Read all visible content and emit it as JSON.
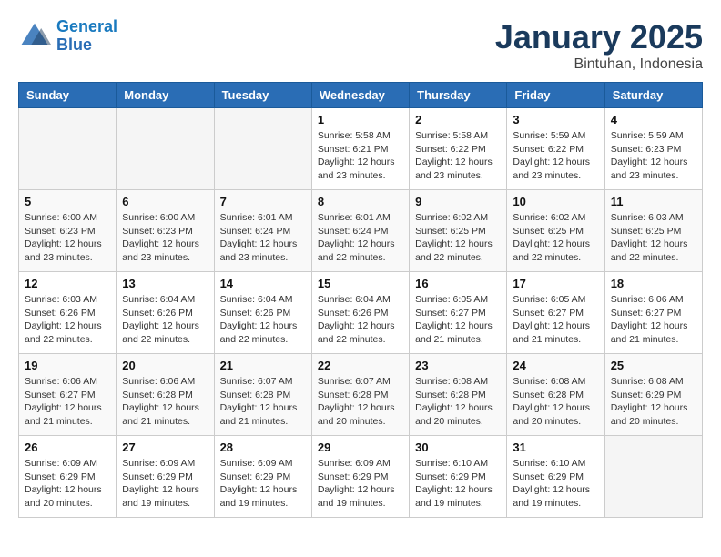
{
  "header": {
    "logo_line1": "General",
    "logo_line2": "Blue",
    "month_title": "January 2025",
    "location": "Bintuhan, Indonesia"
  },
  "weekdays": [
    "Sunday",
    "Monday",
    "Tuesday",
    "Wednesday",
    "Thursday",
    "Friday",
    "Saturday"
  ],
  "weeks": [
    [
      {
        "day": "",
        "sunrise": "",
        "sunset": "",
        "daylight": ""
      },
      {
        "day": "",
        "sunrise": "",
        "sunset": "",
        "daylight": ""
      },
      {
        "day": "",
        "sunrise": "",
        "sunset": "",
        "daylight": ""
      },
      {
        "day": "1",
        "sunrise": "Sunrise: 5:58 AM",
        "sunset": "Sunset: 6:21 PM",
        "daylight": "Daylight: 12 hours and 23 minutes."
      },
      {
        "day": "2",
        "sunrise": "Sunrise: 5:58 AM",
        "sunset": "Sunset: 6:22 PM",
        "daylight": "Daylight: 12 hours and 23 minutes."
      },
      {
        "day": "3",
        "sunrise": "Sunrise: 5:59 AM",
        "sunset": "Sunset: 6:22 PM",
        "daylight": "Daylight: 12 hours and 23 minutes."
      },
      {
        "day": "4",
        "sunrise": "Sunrise: 5:59 AM",
        "sunset": "Sunset: 6:23 PM",
        "daylight": "Daylight: 12 hours and 23 minutes."
      }
    ],
    [
      {
        "day": "5",
        "sunrise": "Sunrise: 6:00 AM",
        "sunset": "Sunset: 6:23 PM",
        "daylight": "Daylight: 12 hours and 23 minutes."
      },
      {
        "day": "6",
        "sunrise": "Sunrise: 6:00 AM",
        "sunset": "Sunset: 6:23 PM",
        "daylight": "Daylight: 12 hours and 23 minutes."
      },
      {
        "day": "7",
        "sunrise": "Sunrise: 6:01 AM",
        "sunset": "Sunset: 6:24 PM",
        "daylight": "Daylight: 12 hours and 23 minutes."
      },
      {
        "day": "8",
        "sunrise": "Sunrise: 6:01 AM",
        "sunset": "Sunset: 6:24 PM",
        "daylight": "Daylight: 12 hours and 22 minutes."
      },
      {
        "day": "9",
        "sunrise": "Sunrise: 6:02 AM",
        "sunset": "Sunset: 6:25 PM",
        "daylight": "Daylight: 12 hours and 22 minutes."
      },
      {
        "day": "10",
        "sunrise": "Sunrise: 6:02 AM",
        "sunset": "Sunset: 6:25 PM",
        "daylight": "Daylight: 12 hours and 22 minutes."
      },
      {
        "day": "11",
        "sunrise": "Sunrise: 6:03 AM",
        "sunset": "Sunset: 6:25 PM",
        "daylight": "Daylight: 12 hours and 22 minutes."
      }
    ],
    [
      {
        "day": "12",
        "sunrise": "Sunrise: 6:03 AM",
        "sunset": "Sunset: 6:26 PM",
        "daylight": "Daylight: 12 hours and 22 minutes."
      },
      {
        "day": "13",
        "sunrise": "Sunrise: 6:04 AM",
        "sunset": "Sunset: 6:26 PM",
        "daylight": "Daylight: 12 hours and 22 minutes."
      },
      {
        "day": "14",
        "sunrise": "Sunrise: 6:04 AM",
        "sunset": "Sunset: 6:26 PM",
        "daylight": "Daylight: 12 hours and 22 minutes."
      },
      {
        "day": "15",
        "sunrise": "Sunrise: 6:04 AM",
        "sunset": "Sunset: 6:26 PM",
        "daylight": "Daylight: 12 hours and 22 minutes."
      },
      {
        "day": "16",
        "sunrise": "Sunrise: 6:05 AM",
        "sunset": "Sunset: 6:27 PM",
        "daylight": "Daylight: 12 hours and 21 minutes."
      },
      {
        "day": "17",
        "sunrise": "Sunrise: 6:05 AM",
        "sunset": "Sunset: 6:27 PM",
        "daylight": "Daylight: 12 hours and 21 minutes."
      },
      {
        "day": "18",
        "sunrise": "Sunrise: 6:06 AM",
        "sunset": "Sunset: 6:27 PM",
        "daylight": "Daylight: 12 hours and 21 minutes."
      }
    ],
    [
      {
        "day": "19",
        "sunrise": "Sunrise: 6:06 AM",
        "sunset": "Sunset: 6:27 PM",
        "daylight": "Daylight: 12 hours and 21 minutes."
      },
      {
        "day": "20",
        "sunrise": "Sunrise: 6:06 AM",
        "sunset": "Sunset: 6:28 PM",
        "daylight": "Daylight: 12 hours and 21 minutes."
      },
      {
        "day": "21",
        "sunrise": "Sunrise: 6:07 AM",
        "sunset": "Sunset: 6:28 PM",
        "daylight": "Daylight: 12 hours and 21 minutes."
      },
      {
        "day": "22",
        "sunrise": "Sunrise: 6:07 AM",
        "sunset": "Sunset: 6:28 PM",
        "daylight": "Daylight: 12 hours and 20 minutes."
      },
      {
        "day": "23",
        "sunrise": "Sunrise: 6:08 AM",
        "sunset": "Sunset: 6:28 PM",
        "daylight": "Daylight: 12 hours and 20 minutes."
      },
      {
        "day": "24",
        "sunrise": "Sunrise: 6:08 AM",
        "sunset": "Sunset: 6:28 PM",
        "daylight": "Daylight: 12 hours and 20 minutes."
      },
      {
        "day": "25",
        "sunrise": "Sunrise: 6:08 AM",
        "sunset": "Sunset: 6:29 PM",
        "daylight": "Daylight: 12 hours and 20 minutes."
      }
    ],
    [
      {
        "day": "26",
        "sunrise": "Sunrise: 6:09 AM",
        "sunset": "Sunset: 6:29 PM",
        "daylight": "Daylight: 12 hours and 20 minutes."
      },
      {
        "day": "27",
        "sunrise": "Sunrise: 6:09 AM",
        "sunset": "Sunset: 6:29 PM",
        "daylight": "Daylight: 12 hours and 19 minutes."
      },
      {
        "day": "28",
        "sunrise": "Sunrise: 6:09 AM",
        "sunset": "Sunset: 6:29 PM",
        "daylight": "Daylight: 12 hours and 19 minutes."
      },
      {
        "day": "29",
        "sunrise": "Sunrise: 6:09 AM",
        "sunset": "Sunset: 6:29 PM",
        "daylight": "Daylight: 12 hours and 19 minutes."
      },
      {
        "day": "30",
        "sunrise": "Sunrise: 6:10 AM",
        "sunset": "Sunset: 6:29 PM",
        "daylight": "Daylight: 12 hours and 19 minutes."
      },
      {
        "day": "31",
        "sunrise": "Sunrise: 6:10 AM",
        "sunset": "Sunset: 6:29 PM",
        "daylight": "Daylight: 12 hours and 19 minutes."
      },
      {
        "day": "",
        "sunrise": "",
        "sunset": "",
        "daylight": ""
      }
    ]
  ]
}
